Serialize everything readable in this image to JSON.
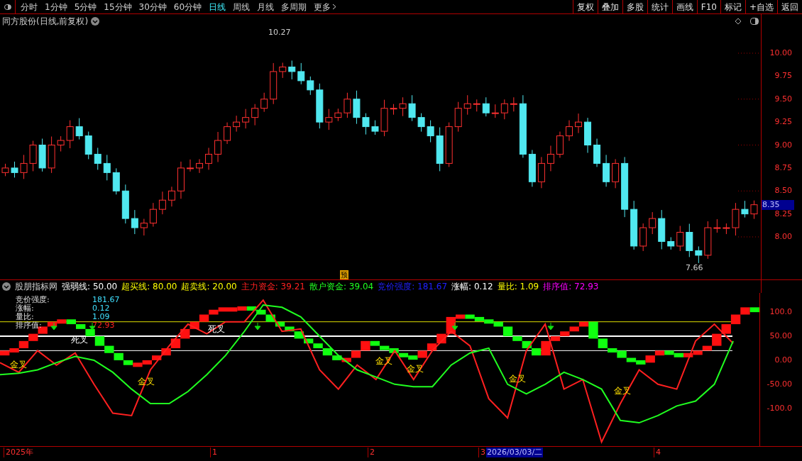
{
  "toolbar": {
    "tabs": [
      {
        "label": "分时",
        "selected": false
      },
      {
        "label": "1分钟",
        "selected": false
      },
      {
        "label": "5分钟",
        "selected": false
      },
      {
        "label": "15分钟",
        "selected": false
      },
      {
        "label": "30分钟",
        "selected": false
      },
      {
        "label": "60分钟",
        "selected": false
      },
      {
        "label": "日线",
        "selected": true
      },
      {
        "label": "周线",
        "selected": false
      },
      {
        "label": "月线",
        "selected": false
      },
      {
        "label": "多周期",
        "selected": false
      },
      {
        "label": "更多",
        "selected": false
      }
    ],
    "buttons": [
      "复权",
      "叠加",
      "多股",
      "统计",
      "画线",
      "F10",
      "标记",
      "+自选",
      "返回"
    ]
  },
  "price_chart": {
    "title": "同方股份(日线,前复权)",
    "high_label": "10.27",
    "low_label": "7.66",
    "marker": "预",
    "current_price": "8.35",
    "axis_labels": [
      "10.00",
      "9.75",
      "9.50",
      "9.25",
      "9.00",
      "8.75",
      "8.50",
      "8.25",
      "8.00"
    ]
  },
  "indicator": {
    "title": "股朋指标网",
    "legend": [
      {
        "label": "强弱线:",
        "value": "50.00",
        "color": "#ffffff"
      },
      {
        "label": "超买线:",
        "value": "80.00",
        "color": "#ffff00"
      },
      {
        "label": "超卖线:",
        "value": "20.00",
        "color": "#ffff00"
      },
      {
        "kind": "series",
        "value": "39.21",
        "color": "#ff2020"
      },
      {
        "kind": "series",
        "value": "39.04",
        "color": "#20ff20"
      },
      {
        "label": "竞价强度:",
        "value": "181.67",
        "color": "#2020ff"
      },
      {
        "label": "涨幅:",
        "value": "0.12",
        "color": "#ffffff"
      },
      {
        "label": "量比:",
        "value": "1.09",
        "color": "#ffff00"
      },
      {
        "label": "排序值:",
        "value": "72.93",
        "color": "#ff00ff"
      }
    ],
    "overlay": [
      {
        "label": "竞价强度:",
        "value": "181.67",
        "color": "#40e0ff"
      },
      {
        "label": "涨幅:",
        "value": "0.12",
        "color": "#40e0ff"
      },
      {
        "label": "量比:",
        "value": "1.09",
        "color": "#40e0ff"
      },
      {
        "label": "排序值:",
        "value": "72.93",
        "color": "#ff2020"
      }
    ],
    "cross_labels": [
      {
        "text": "金叉",
        "kind": "golden"
      },
      {
        "text": "死叉",
        "kind": "death"
      },
      {
        "text": "金叉",
        "kind": "golden"
      },
      {
        "text": "死叉",
        "kind": "death"
      },
      {
        "text": "金叉",
        "kind": "golden"
      },
      {
        "text": "金叉",
        "kind": "golden"
      },
      {
        "text": "金叉",
        "kind": "golden"
      },
      {
        "text": "金叉",
        "kind": "golden"
      }
    ],
    "chart_data": {
      "type": "line",
      "ylim": [
        -180,
        140
      ],
      "yticks": [
        {
          "value": 100,
          "label": "100.0"
        },
        {
          "value": 50,
          "label": "50.00"
        },
        {
          "value": 0,
          "label": "0.00"
        },
        {
          "value": -50,
          "label": "-50.00"
        },
        {
          "value": -100,
          "label": "-100.0"
        }
      ],
      "series": [
        {
          "name": "主力资金:",
          "color": "#ff2020",
          "values": [
            -5,
            -25,
            20,
            -10,
            15,
            -50,
            -110,
            -115,
            -20,
            30,
            75,
            55,
            80,
            80,
            125,
            60,
            65,
            -20,
            -60,
            -10,
            -40,
            20,
            -40,
            20,
            60,
            30,
            -80,
            -120,
            20,
            75,
            -60,
            -40,
            -170,
            -90,
            -20,
            -50,
            -60,
            40,
            75,
            35
          ]
        },
        {
          "name": "散户资金:",
          "color": "#20ff20",
          "values": [
            -30,
            -27,
            -20,
            -5,
            8,
            0,
            -25,
            -60,
            -90,
            -90,
            -65,
            -30,
            10,
            60,
            115,
            110,
            90,
            50,
            10,
            -20,
            -35,
            -50,
            -55,
            -55,
            -10,
            15,
            25,
            -50,
            -70,
            -50,
            -25,
            -40,
            -60,
            -125,
            -130,
            -115,
            -95,
            -85,
            -50,
            40
          ]
        }
      ]
    }
  },
  "date_axis": [
    {
      "text": "2025年",
      "kind": "label"
    },
    {
      "text": "1",
      "kind": "label"
    },
    {
      "text": "2",
      "kind": "label"
    },
    {
      "text": "3",
      "kind": "label"
    },
    {
      "text": "2026/03/03/二",
      "kind": "cursor"
    },
    {
      "text": "4",
      "kind": "label"
    }
  ]
}
